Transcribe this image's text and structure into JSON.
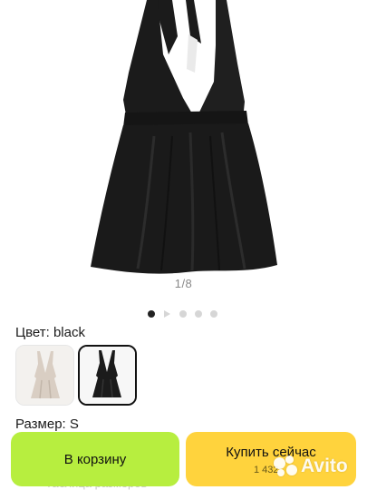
{
  "gallery": {
    "counter": "1/8",
    "dots_count": 5,
    "active_dot": 0
  },
  "options": {
    "color_label": "Цвет: black",
    "size_label": "Размер: S",
    "swatches": [
      "beige-dress-swatch",
      "black-dress-swatch"
    ]
  },
  "actions": {
    "cart_label": "В корзину",
    "buy_label": "Купить сейчас",
    "buy_price": "1 432"
  },
  "faded_text": "Таблица размеров",
  "watermark": "Avito",
  "colors": {
    "cart_button": "#b7ee3f",
    "buy_button": "#ffd33d",
    "dress": "#1b1b1b",
    "beige_dress": "#d9cec3"
  }
}
